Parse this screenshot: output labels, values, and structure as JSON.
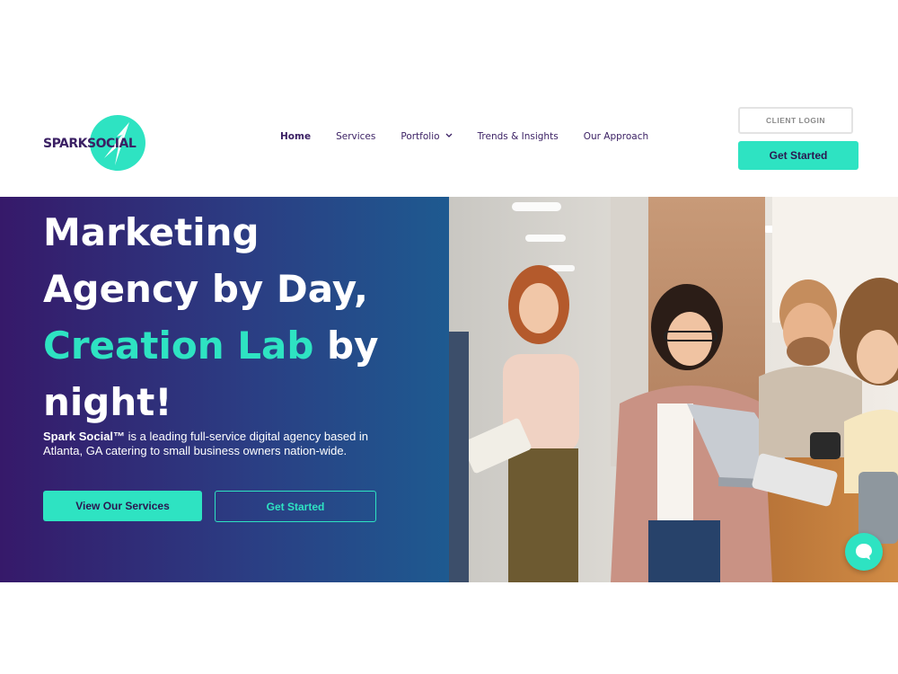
{
  "brand": {
    "part1": "SPARK",
    "part2": "SOCIAL",
    "logo_icon": "spark-logo-icon",
    "accent": "#2ee3c2",
    "primary": "#36196a"
  },
  "nav": {
    "items": [
      {
        "label": "Home",
        "active": true
      },
      {
        "label": "Services"
      },
      {
        "label": "Portfolio",
        "icon": "chevron-down-icon"
      },
      {
        "label": "Trends & Insights"
      },
      {
        "label": "Our Approach"
      }
    ]
  },
  "header": {
    "client_login": "CLIENT LOGIN",
    "cta": "Get Started"
  },
  "hero": {
    "title_line1": "Marketing",
    "title_line2": "Agency by Day,",
    "title_accent": "Creation Lab",
    "title_line3_rest": " by",
    "title_line4": "night!",
    "desc_brand": "Spark Social™",
    "desc_rest": " is a leading full-service digital agency based in Atlanta, GA catering to small business owners nation-wide.",
    "btn_services": "View Our Services",
    "btn_get_started": "Get Started",
    "photo_icon": "team-office-photo"
  },
  "chat": {
    "icon": "chat-bubble-icon"
  }
}
